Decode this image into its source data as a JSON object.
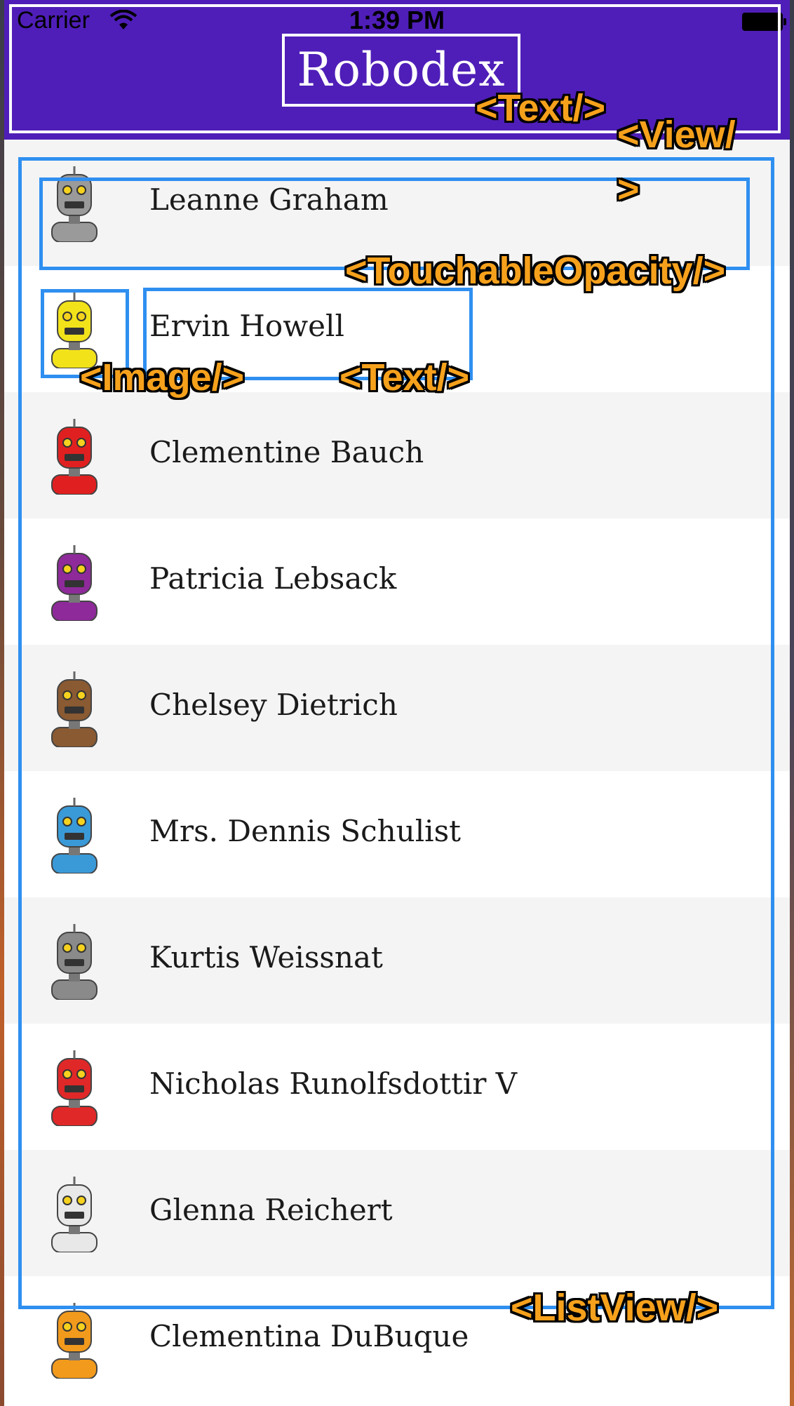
{
  "status_bar": {
    "carrier": "Carrier",
    "time": "1:39 PM"
  },
  "header": {
    "title": "Robodex",
    "color": "#4f1eb8"
  },
  "robots": [
    {
      "name": "Leanne Graham",
      "avatar_icon": "robot-gray-icon",
      "color": "#9a9a9a"
    },
    {
      "name": "Ervin Howell",
      "avatar_icon": "robot-yellow-icon",
      "color": "#f2e21a"
    },
    {
      "name": "Clementine Bauch",
      "avatar_icon": "robot-red-icon",
      "color": "#e02020"
    },
    {
      "name": "Patricia Lebsack",
      "avatar_icon": "robot-purple-icon",
      "color": "#8e2a9a"
    },
    {
      "name": "Chelsey Dietrich",
      "avatar_icon": "robot-brown-icon",
      "color": "#8a5a32"
    },
    {
      "name": "Mrs. Dennis Schulist",
      "avatar_icon": "robot-blue-icon",
      "color": "#3a9ad8"
    },
    {
      "name": "Kurtis Weissnat",
      "avatar_icon": "robot-gray-icon",
      "color": "#8a8a8a"
    },
    {
      "name": "Nicholas Runolfsdottir V",
      "avatar_icon": "robot-red-icon",
      "color": "#e02828"
    },
    {
      "name": "Glenna Reichert",
      "avatar_icon": "robot-white-icon",
      "color": "#e8e8e8"
    },
    {
      "name": "Clementina DuBuque",
      "avatar_icon": "robot-orange-icon",
      "color": "#f29a1c"
    }
  ],
  "annotations": {
    "text_header": "<Text/>",
    "view_line1": "<View/",
    "view_line2": ">",
    "touchable": "<TouchableOpacity/>",
    "image": "<Image/>",
    "text_row": "<Text/>",
    "listview": "<ListView/>",
    "box_color": "#2f8ff0",
    "label_color": "#f6a11c"
  }
}
